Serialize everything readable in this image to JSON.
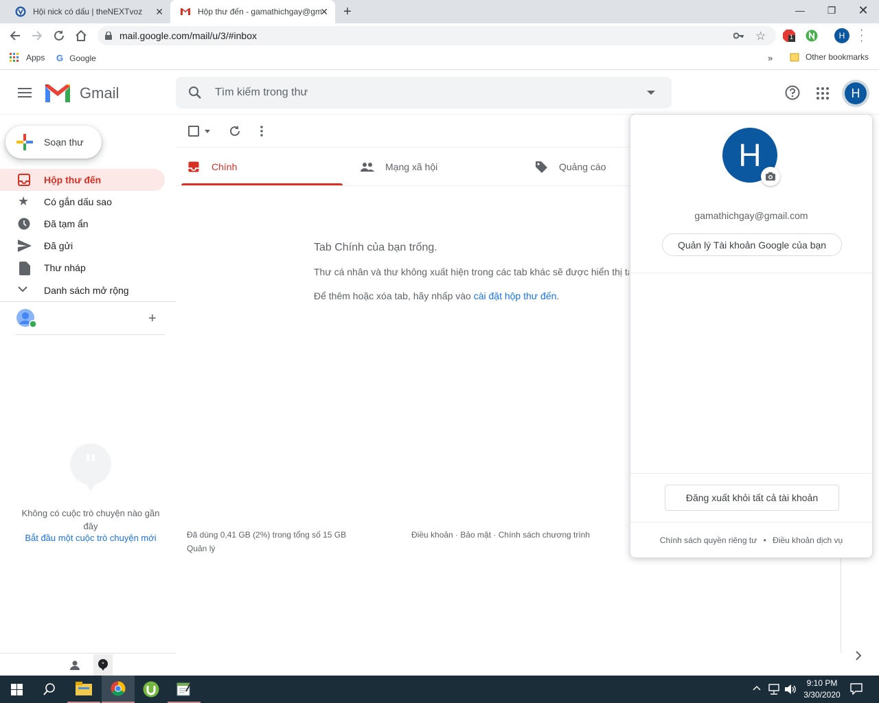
{
  "browser": {
    "tabs": [
      {
        "title": "Hội nick có dấu | theNEXTvoz",
        "active": false
      },
      {
        "title": "Hộp thư đến - gamathichgay@gmail.com",
        "active": true
      }
    ],
    "url": "mail.google.com/mail/u/3/#inbox",
    "profile_initial": "H",
    "extension_badge": "1",
    "bookmarks": {
      "apps": "Apps",
      "google": "Google",
      "other": "Other bookmarks"
    }
  },
  "gmail": {
    "logo_text": "Gmail",
    "search_placeholder": "Tìm kiếm trong thư",
    "avatar_initial": "H",
    "compose_label": "Soạn thư",
    "nav": [
      {
        "label": "Hộp thư đến",
        "icon": "inbox-icon"
      },
      {
        "label": "Có gắn dấu sao",
        "icon": "star-icon"
      },
      {
        "label": "Đã tạm ẩn",
        "icon": "clock-icon"
      },
      {
        "label": "Đã gửi",
        "icon": "send-icon"
      },
      {
        "label": "Thư nháp",
        "icon": "draft-icon"
      },
      {
        "label": "Danh sách mở rộng",
        "icon": "chevron-down-icon"
      }
    ],
    "hangouts": {
      "empty_text": "Không có cuộc trò chuyện nào gần đây",
      "start_link": "Bắt đầu một cuộc trò chuyện mới"
    },
    "tabs": [
      {
        "label": "Chính",
        "icon": "inbox-icon"
      },
      {
        "label": "Mạng xã hội",
        "icon": "people-icon"
      },
      {
        "label": "Quảng cáo",
        "icon": "tag-icon"
      }
    ],
    "empty": {
      "title": "Tab Chính của bạn trống.",
      "line1": "Thư cá nhân và thư không xuất hiện trong các tab khác sẽ được hiển thị tạ",
      "line2_prefix": "Để thêm hoặc xóa tab, hãy nhấp vào ",
      "line2_link": "cài đặt hộp thư đến",
      "line2_suffix": "."
    },
    "footer": {
      "storage": "Đã dùng 0,41 GB (2%) trong tổng số 15 GB",
      "manage": "Quản lý",
      "links": "Điều khoản · Bảo mật · Chính sách chương trình"
    }
  },
  "account_panel": {
    "initial": "H",
    "email": "gamathichgay@gmail.com",
    "manage_button": "Quản lý Tài khoản Google của bạn",
    "signout_button": "Đăng xuất khỏi tất cả tài khoản",
    "privacy": "Chính sách quyền riêng tư",
    "separator": "•",
    "terms": "Điều khoản dịch vụ"
  },
  "taskbar": {
    "time": "9:10 PM",
    "date": "3/30/2020"
  },
  "colors": {
    "gmail_red": "#d93025",
    "avatar_blue": "#0b57a0",
    "link_blue": "#1a73e8",
    "taskbar": "#1c2d3a"
  }
}
